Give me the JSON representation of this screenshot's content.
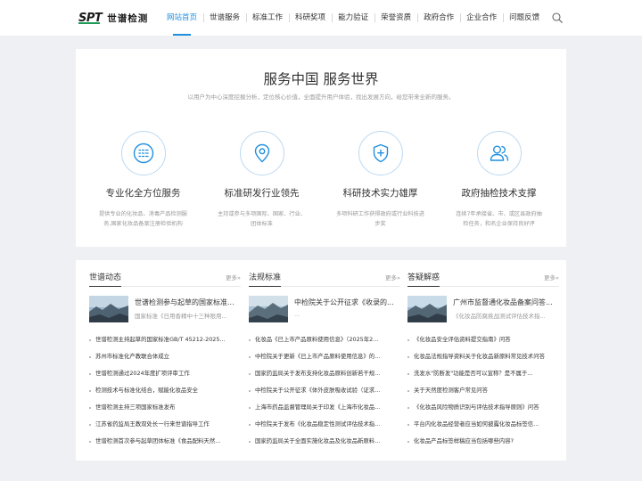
{
  "header": {
    "logo_mark": "SPT",
    "logo_text": "世谱检测",
    "nav": [
      "网站首页",
      "世谱服务",
      "标准工作",
      "科研奖项",
      "能力验证",
      "荣誉资质",
      "政府合作",
      "企业合作",
      "问题反馈"
    ],
    "active_index": 0,
    "search_icon": "search-icon"
  },
  "services": {
    "title": "服务中国 服务世界",
    "subtitle": "以用户为中心深度挖掘分析，定位核心价值，全面提升用户体验，找出发展方向，给您带来全新的服务。",
    "items": [
      {
        "icon": "grid-icon",
        "name": "专业化全方位服务",
        "desc": "提供专业的化妆品、消毒产品检测服务,国家化妆品备案注册检验机构"
      },
      {
        "icon": "location-pin-icon",
        "name": "标准研发行业领先",
        "desc": "主持或参与多项国际、国家、行业、团体标准"
      },
      {
        "icon": "shield-plus-icon",
        "name": "科研技术实力雄厚",
        "desc": "多项科研工作获得政府或行业科技进步奖"
      },
      {
        "icon": "users-icon",
        "name": "政府抽检技术支撑",
        "desc": "连续7年承接省、市、或区县政府抽检任务，和名企业保持良好评"
      }
    ],
    "accent_color": "#1f8fe0"
  },
  "news": {
    "more_label": "更多»",
    "columns": [
      {
        "title": "世谱动态",
        "featured": {
          "title": "世谱检测参与起草的国家标准...",
          "desc": "国家标准《日用香精中十三种限用..."
        },
        "items": [
          "世谱检测主持起草的国家标准GB/T 45212-2025...",
          "苏州市标准化产教联合体成立",
          "世谱检测通过2024年度扩项评审工作",
          "检测技术与标准化结合，赋能化妆品安全",
          "世谱检测主持三项国家标准发布",
          "江苏省药监局王教双处长一行来世谱指导工作",
          "世谱检测首次参与起草团体标准《食品配料天然..."
        ]
      },
      {
        "title": "法规标准",
        "featured": {
          "title": "中检院关于公开征求《收录的...",
          "desc": "..."
        },
        "items": [
          "化妆品《已上市产品原料使用信息》（2025年2...",
          "中检院关于更新《已上市产品原料使用信息》的...",
          "国家药监局关于发布支持化妆品原料创新若干规...",
          "中检院关于公开征求《体外皮肤吸收试验（证求...",
          "上海市药品监督管理局关于印发《上海市化妆品...",
          "中检院关于发布《化妆品稳定性测试评估技术指...",
          "国家药监局关于全面实施化妆品及化妆品新原料..."
        ]
      },
      {
        "title": "答疑解惑",
        "featured": {
          "title": "广州市监督通化妆品备案问答...",
          "desc": "《化妆品防腐挑战测试评估技术指..."
        },
        "items": [
          "《化妆品安全评估资料提交指南》问答",
          "化妆品法规指导资料关于化妆品新原料常见技术问答",
          "洗发水\"防断发\"功能是否可以宣称？是不属于...",
          "关于天然度检测客户常见问答",
          "《化妆品风险物质识别与评估技术指导原则》问答",
          "平台内化妆品经营者应当如何披露化妆品标签信...",
          "化妆品产品标签样稿应当包括哪些内容?"
        ]
      }
    ]
  }
}
